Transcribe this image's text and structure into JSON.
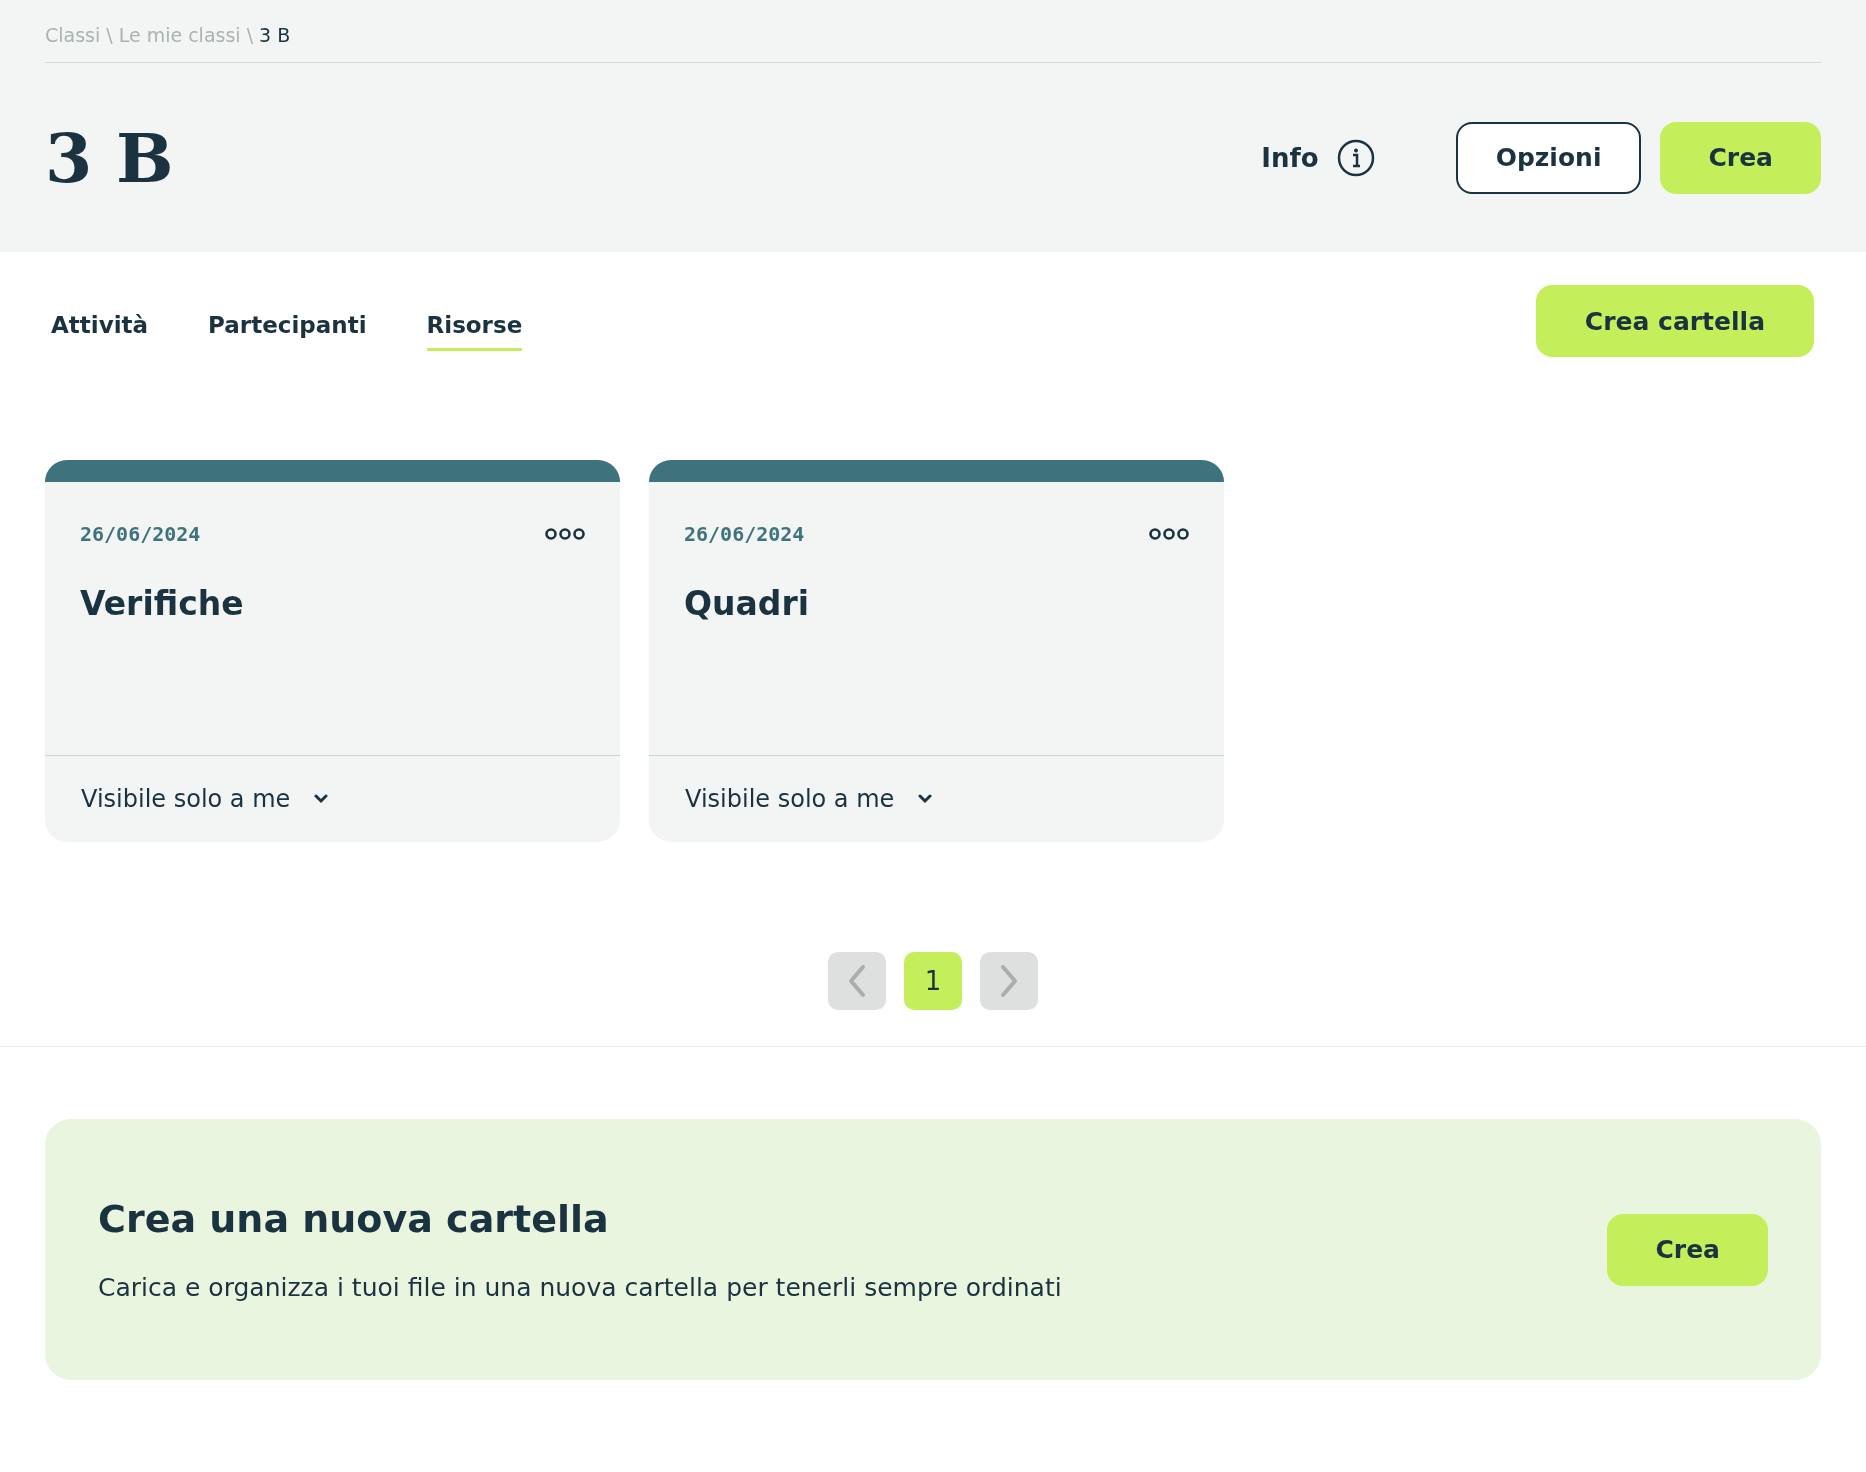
{
  "breadcrumb": [
    {
      "label": "Classi",
      "current": false
    },
    {
      "label": "Le mie classi",
      "current": false
    },
    {
      "label": "3 B",
      "current": true
    }
  ],
  "breadcrumb_separator": "\\",
  "title": "3 B",
  "header_actions": {
    "info": "Info",
    "options": "Opzioni",
    "create": "Crea"
  },
  "tabs": [
    {
      "label": "Attività",
      "selected": false
    },
    {
      "label": "Partecipanti",
      "selected": false
    },
    {
      "label": "Risorse",
      "selected": true
    }
  ],
  "create_folder_button": "Crea cartella",
  "folders": [
    {
      "date": "26/06/2024",
      "name": "Verifiche",
      "visibility": "Visibile solo a me"
    },
    {
      "date": "26/06/2024",
      "name": "Quadri",
      "visibility": "Visibile solo a me"
    }
  ],
  "pagination": {
    "previous_disabled": true,
    "pages": [
      {
        "label": "1",
        "selected": true
      }
    ],
    "next_disabled": true
  },
  "banner": {
    "title": "Crea una nuova cartella",
    "text": "Carica e organizza i tuoi file in una nuova cartella per tenerli sempre ordinati",
    "button": "Crea"
  }
}
